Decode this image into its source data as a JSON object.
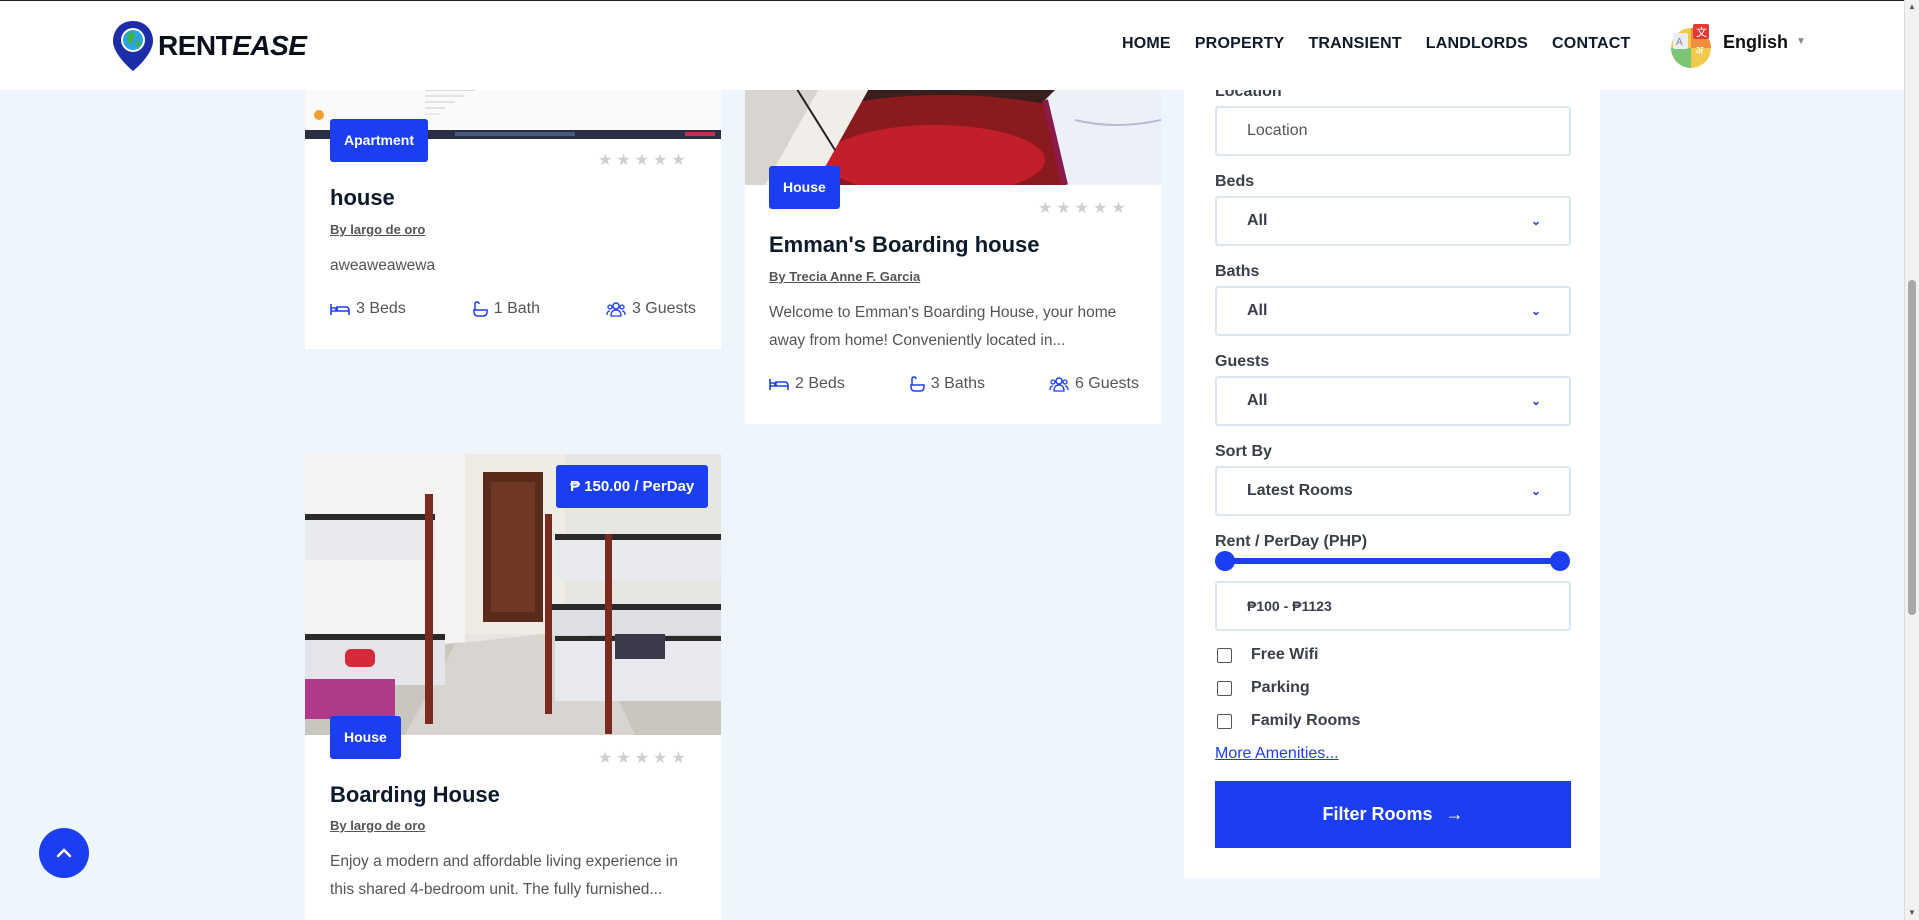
{
  "brand": {
    "name_a": "RENT",
    "name_b": "EASE"
  },
  "nav": [
    "HOME",
    "PROPERTY",
    "TRANSIENT",
    "LANDLORDS",
    "CONTACT"
  ],
  "language": {
    "label": "English",
    "icon": "translate-icon"
  },
  "colors": {
    "accent": "#1b3ff0",
    "page_bg": "#eef5fd"
  },
  "cards": [
    {
      "type": "Apartment",
      "title": "house",
      "author": "By largo de oro",
      "description": "aweaweawewa",
      "beds": "3 Beds",
      "baths": "1 Bath",
      "guests": "3 Guests",
      "rating": 0
    },
    {
      "type": "House",
      "title": "Emman's Boarding house",
      "author": "By Trecia Anne F. Garcia",
      "description": "Welcome to Emman's Boarding House, your home away from home! Conveniently located in...",
      "beds": "2 Beds",
      "baths": "3 Baths",
      "guests": "6 Guests",
      "rating": 0
    },
    {
      "type": "House",
      "price": "₱ 150.00 / PerDay",
      "title": "Boarding House",
      "author": "By largo de oro",
      "description": "Enjoy a modern and affordable living experience in this shared 4-bedroom unit. The fully furnished...",
      "rating": 0
    }
  ],
  "filters": {
    "location_label": "Location",
    "location_placeholder": "Location",
    "beds_label": "Beds",
    "beds_value": "All",
    "baths_label": "Baths",
    "baths_value": "All",
    "guests_label": "Guests",
    "guests_value": "All",
    "sort_label": "Sort By",
    "sort_value": "Latest Rooms",
    "rent_label": "Rent / PerDay (PHP)",
    "rent_range": "₱100 - ₱1123",
    "amenities": [
      "Free Wifi",
      "Parking",
      "Family Rooms"
    ],
    "more_link": "More Amenities...",
    "submit": "Filter Rooms"
  }
}
